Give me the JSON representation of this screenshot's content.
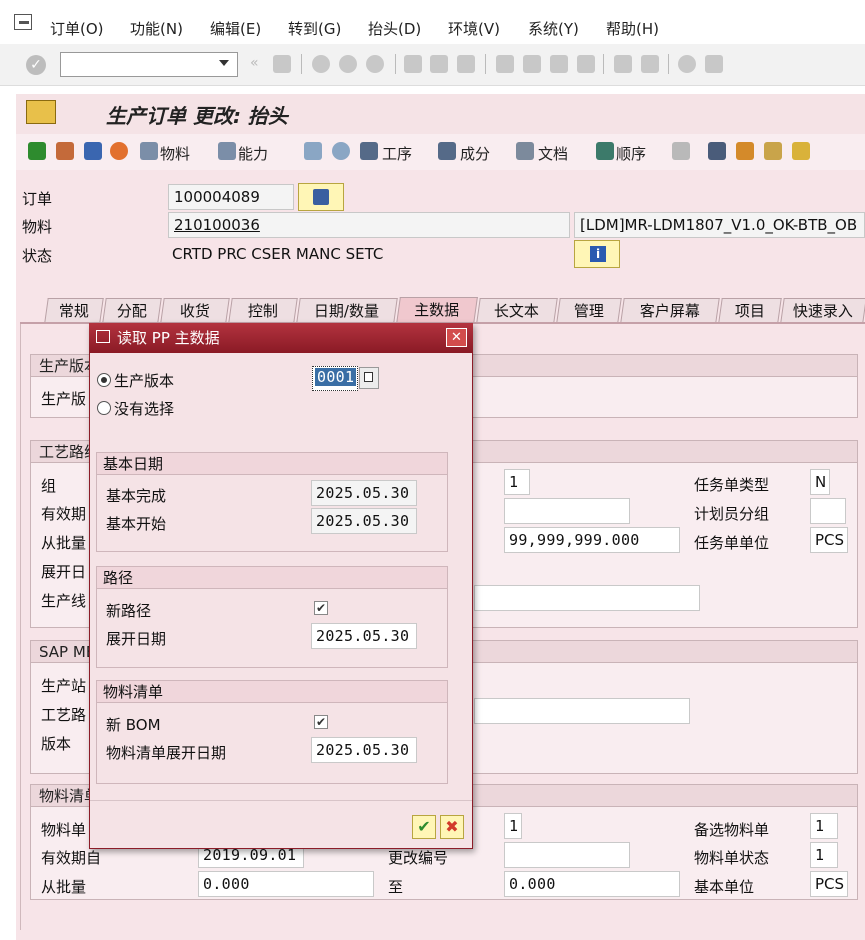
{
  "menubar": {
    "items": [
      "订单(O)",
      "功能(N)",
      "编辑(E)",
      "转到(G)",
      "抬头(D)",
      "环境(V)",
      "系统(Y)",
      "帮助(H)"
    ]
  },
  "title": "生产订单 更改: 抬头",
  "appbar": {
    "material_label": "物料",
    "capacity_label": "能力",
    "operation_label": "工序",
    "component_label": "成分",
    "document_label": "文档",
    "sequence_label": "顺序"
  },
  "header": {
    "order_label": "订单",
    "order_value": "100004089",
    "material_label": "物料",
    "material_value": "210100036",
    "material_desc": "[LDM]MR-LDM1807_V1.0_OK-BTB_OB",
    "status_label": "状态",
    "status_value": "CRTD PRC  CSER MANC SETC"
  },
  "tabs": [
    "常规",
    "分配",
    "收货",
    "控制",
    "日期/数量",
    "主数据",
    "长文本",
    "管理",
    "客户屏幕",
    "项目",
    "快速录入"
  ],
  "active_tab": "主数据",
  "background": {
    "g1_title": "生产版本",
    "g1_row1": "生产版",
    "g2_title": "工艺路线",
    "g2_row_group": "组",
    "g2_row_valid": "有效期",
    "g2_row_from": "从批量",
    "g2_row_expl": "展开日",
    "g2_row_line": "生产线",
    "g2_counter": "1",
    "g2_to_qty": "99,999,999.000",
    "g2_task_type_label": "任务单类型",
    "g2_task_type_value": "N",
    "g2_planner_label": "计划员分组",
    "g2_unit_label": "任务单单位",
    "g2_unit_value": "PCS",
    "g3_title": "SAP ME",
    "g3_row1": "生产站",
    "g3_row2": "工艺路",
    "g3_row3": "版本",
    "g4_title": "物料清单",
    "g4_row1": "物料单",
    "g4_row2": "有效期自",
    "g4_row2_value": "2019.09.01",
    "g4_change_label": "更改编号",
    "g4_row3": "从批量",
    "g4_from_value": "0.000",
    "g4_to_label": "至",
    "g4_to_value": "0.000",
    "g4_counter": "1",
    "g4_alt_label": "备选物料单",
    "g4_alt_value": "1",
    "g4_status_label": "物料单状态",
    "g4_status_value": "1",
    "g4_unit_label": "基本单位",
    "g4_unit_value": "PCS"
  },
  "dialog": {
    "title": "读取 PP 主数据",
    "radio_version_label": "生产版本",
    "version_value": "0001",
    "radio_none_label": "没有选择",
    "basic_dates_title": "基本日期",
    "basic_finish_label": "基本完成",
    "basic_finish_value": "2025.05.30",
    "basic_start_label": "基本开始",
    "basic_start_value": "2025.05.30",
    "routing_title": "路径",
    "new_routing_label": "新路径",
    "routing_expl_label": "展开日期",
    "routing_expl_value": "2025.05.30",
    "bom_title": "物料清单",
    "new_bom_label": "新 BOM",
    "bom_expl_label": "物料清单展开日期",
    "bom_expl_value": "2025.05.30",
    "checkmark": "✔",
    "cross": "✖",
    "close": "✕"
  }
}
